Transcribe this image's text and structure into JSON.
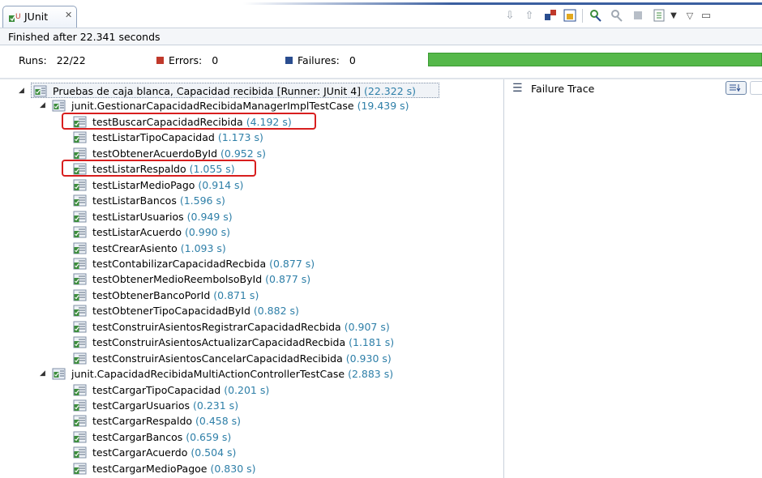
{
  "view": {
    "tab_title": "JUnit",
    "tab_close": "✕",
    "status": "Finished after 22.341 seconds"
  },
  "toolbar": {
    "icons": [
      "next-failure-icon",
      "previous-failure-icon",
      "show-failures-only-icon",
      "scroll-lock-icon",
      "rerun-icon",
      "rerun-failed-first-icon",
      "stop-icon",
      "history-icon",
      "dropdown-icon",
      "view-menu-icon",
      "minimize-icon"
    ]
  },
  "counters": {
    "runs_label": "Runs:",
    "runs_value": "22/22",
    "errors_label": "Errors:",
    "errors_value": "0",
    "failures_label": "Failures:",
    "failures_value": "0",
    "progress": 1.0,
    "progress_color": "#55b84a"
  },
  "tree": {
    "root": {
      "name": "Pruebas de caja blanca, Capacidad recibida [Runner: JUnit 4]",
      "time": "(22.322 s)"
    },
    "suites": [
      {
        "name": "junit.GestionarCapacidadRecibidaManagerImplTestCase",
        "time": "(19.439 s)",
        "tests": [
          {
            "name": "testBuscarCapacidadRecibida",
            "time": "(4.192 s)",
            "highlighted": true
          },
          {
            "name": "testListarTipoCapacidad",
            "time": "(1.173 s)"
          },
          {
            "name": "testObtenerAcuerdoById",
            "time": "(0.952 s)"
          },
          {
            "name": "testListarRespaldo",
            "time": "(1.055 s)",
            "highlighted": true
          },
          {
            "name": "testListarMedioPago",
            "time": "(0.914 s)"
          },
          {
            "name": "testListarBancos",
            "time": "(1.596 s)"
          },
          {
            "name": "testListarUsuarios",
            "time": "(0.949 s)"
          },
          {
            "name": "testListarAcuerdo",
            "time": "(0.990 s)"
          },
          {
            "name": "testCrearAsiento",
            "time": "(1.093 s)"
          },
          {
            "name": "testContabilizarCapacidadRecbida",
            "time": "(0.877 s)"
          },
          {
            "name": "testObtenerMedioReembolsoById",
            "time": "(0.877 s)"
          },
          {
            "name": "testObtenerBancoPorId",
            "time": "(0.871 s)"
          },
          {
            "name": "testObtenerTipoCapacidadById",
            "time": "(0.882 s)"
          },
          {
            "name": "testConstruirAsientosRegistrarCapacidadRecbida",
            "time": "(0.907 s)"
          },
          {
            "name": "testConstruirAsientosActualizarCapacidadRecbida",
            "time": "(1.181 s)"
          },
          {
            "name": "testConstruirAsientosCancelarCapacidadRecibida",
            "time": "(0.930 s)"
          }
        ]
      },
      {
        "name": "junit.CapacidadRecibidaMultiActionControllerTestCase",
        "time": "(2.883 s)",
        "tests": [
          {
            "name": "testCargarTipoCapacidad",
            "time": "(0.201 s)"
          },
          {
            "name": "testCargarUsuarios",
            "time": "(0.231 s)"
          },
          {
            "name": "testCargarRespaldo",
            "time": "(0.458 s)"
          },
          {
            "name": "testCargarBancos",
            "time": "(0.659 s)"
          },
          {
            "name": "testCargarAcuerdo",
            "time": "(0.504 s)"
          },
          {
            "name": "testCargarMedioPagoe",
            "time": "(0.830 s)"
          }
        ]
      }
    ]
  },
  "trace": {
    "title": "Failure Trace"
  },
  "colors": {
    "time_text": "#2e7fa8",
    "highlight_box": "#d81e1e",
    "error_marker": "#c0392b",
    "failure_marker": "#2a4d8f"
  }
}
